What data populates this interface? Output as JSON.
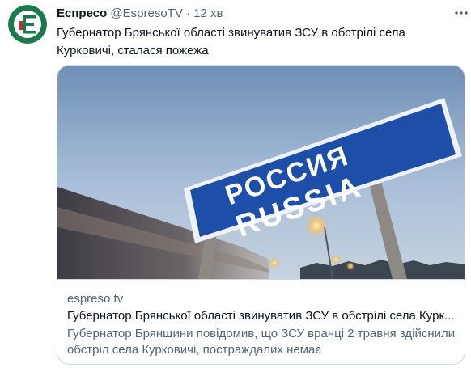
{
  "tweet": {
    "author_name": "Еспресо",
    "author_handle": "@EspresoTV",
    "separator": "·",
    "time": "12 хв",
    "text": "Губернатор Брянської області звинуватив ЗСУ в обстрілі села Курковичі, сталася пожежа",
    "avatar_letter": "E",
    "avatar_icon": "espreso-logo-icon",
    "more_icon": "more-options-icon"
  },
  "card": {
    "image_sign_line1": "РОССИЯ",
    "image_sign_line2": "RUSSIA",
    "domain": "espreso.tv",
    "title": "Губернатор Брянської області звинуватив ЗСУ в обстрілі села Курк...",
    "description": "Губернатор Брянщини повідомив, що ЗСУ вранці 2 травня здійснили обстріл села Курковичі, постраждалих немає"
  },
  "colors": {
    "avatar_bg": "#1a7a4c",
    "avatar_accent": "#d9242b",
    "text_primary": "#0f1419",
    "text_secondary": "#536471",
    "border": "#cfd9de",
    "sign_blue": "#1e4fa8"
  }
}
